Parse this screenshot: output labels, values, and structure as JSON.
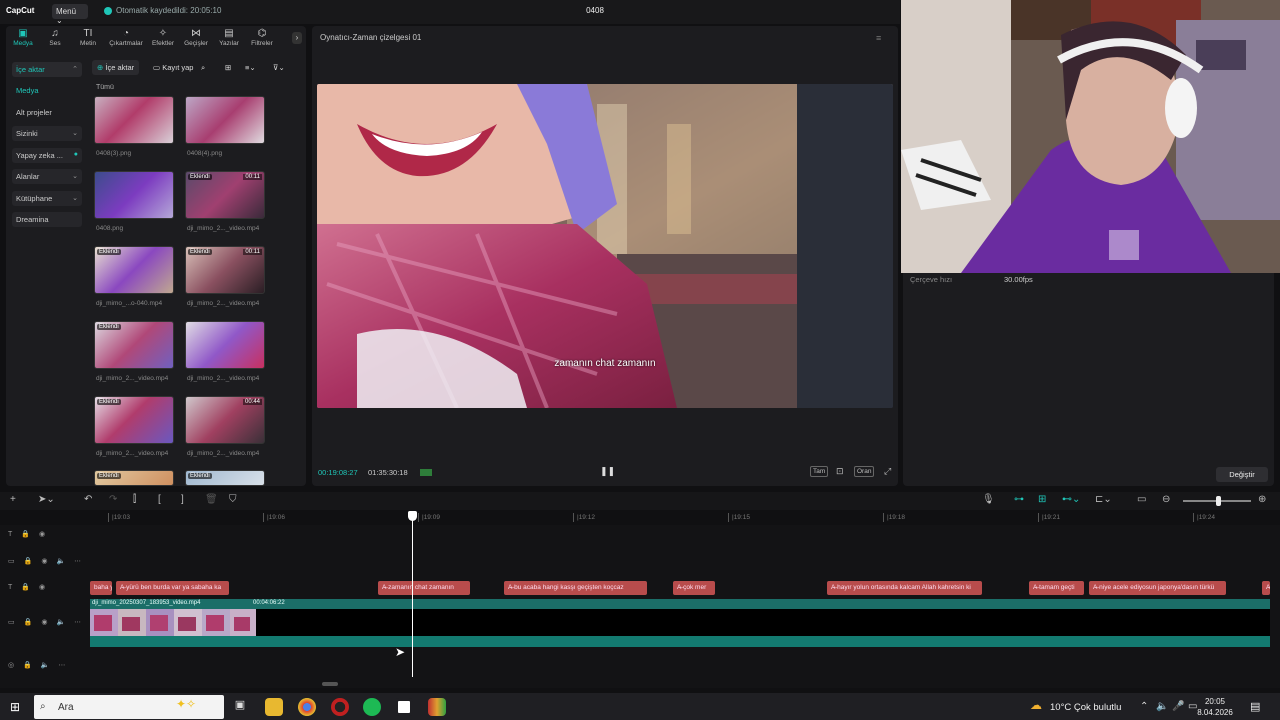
{
  "app": {
    "logo": "CapCut",
    "menu_label": "Menü ⌄",
    "autosave": "Otomatik kaydedildi: 20:05:10",
    "project_title": "0408"
  },
  "tools": [
    {
      "label": "Medya",
      "icon": "media-icon",
      "glyph": "▣"
    },
    {
      "label": "Ses",
      "icon": "audio-icon",
      "glyph": "♫"
    },
    {
      "label": "Metin",
      "icon": "text-icon",
      "glyph": "TI"
    },
    {
      "label": "Çıkartmalar",
      "icon": "sticker-icon",
      "glyph": "◔"
    },
    {
      "label": "Efektler",
      "icon": "effects-icon",
      "glyph": "✧"
    },
    {
      "label": "Geçişler",
      "icon": "transitions-icon",
      "glyph": "⋈"
    },
    {
      "label": "Yazılar",
      "icon": "captions-icon",
      "glyph": "▤"
    },
    {
      "label": "Filtreler",
      "icon": "filters-icon",
      "glyph": "⌬"
    }
  ],
  "nav": {
    "ice_aktar": "İçe aktar",
    "medya": "Medya",
    "alt_projeler": "Alt projeler",
    "sizinki": "Sizinki",
    "yapay_zeka": "Yapay zeka ...",
    "alanlar": "Alanlar",
    "kutuphane": "Kütüphane",
    "dreamina": "Dreamina"
  },
  "media": {
    "import_label": "İçe aktar",
    "record_label": "Kayıt yap",
    "all_label": "Tümü",
    "items": [
      {
        "name": "0408(3).png",
        "badge": "",
        "duration": ""
      },
      {
        "name": "0408(4).png",
        "badge": "",
        "duration": ""
      },
      {
        "name": "0408.png",
        "badge": "",
        "duration": ""
      },
      {
        "name": "dji_mimo_2..._video.mp4",
        "badge": "Eklendi",
        "duration": "00:11"
      },
      {
        "name": "dji_mimo_...o-040.mp4",
        "badge": "Eklendi",
        "duration": ""
      },
      {
        "name": "dji_mimo_2..._video.mp4",
        "badge": "Eklendi",
        "duration": "00:11"
      },
      {
        "name": "dji_mimo_2..._video.mp4",
        "badge": "Eklendi",
        "duration": ""
      },
      {
        "name": "dji_mimo_2..._video.mp4",
        "badge": "",
        "duration": ""
      },
      {
        "name": "dji_mimo_2..._video.mp4",
        "badge": "Eklendi",
        "duration": ""
      },
      {
        "name": "dji_mimo_2..._video.mp4",
        "badge": "",
        "duration": "00:44"
      },
      {
        "name": "",
        "badge": "Eklendi",
        "duration": ""
      },
      {
        "name": "",
        "badge": "Eklendi",
        "duration": ""
      }
    ]
  },
  "player": {
    "title": "Oynatıcı-Zaman çizelgesi 01",
    "subtitle": "zamanın chat zamanın",
    "current_time": "00:19:08:27",
    "total_time": "01:35:30:18",
    "btn_full": "Tam",
    "btn_ratio": "Oran"
  },
  "properties": {
    "frame_rate_label": "Çerçeve hızı",
    "frame_rate_value": "30.00fps",
    "change_label": "Değiştir"
  },
  "timeline": {
    "ruler": [
      "|19:03",
      "|19:06",
      "|19:09",
      "|19:12",
      "|19:15",
      "|19:18",
      "|19:21",
      "|19:24"
    ],
    "subtitles": [
      "baha yü",
      "A̶ yürü ben burda var ya sabaha ka",
      "A̶ zamanın chat zamanın",
      "A̶ bu acaba hangi kasşı geçişten koçcaz",
      "A̶ çok mer",
      "A̶ hayır yolun ortasında kalcam Allah kahretsin ki",
      "A̶ tamam geçti",
      "A̶ niye acele ediyosun japonya'dasın türkü",
      "A̶"
    ],
    "video_clip_label": "dji_mimo_20250307_183953_video.mp4",
    "video_clip_duration": "00:04:06:22"
  },
  "taskbar": {
    "search_placeholder": "Ara",
    "weather": "10°C  Çok bulutlu",
    "time": "20:05",
    "date": "8.04.2026"
  },
  "colors": {
    "accent": "#1fc6b8",
    "subtitle_clip": "#b84c4c",
    "video_track": "#1b6e68"
  }
}
